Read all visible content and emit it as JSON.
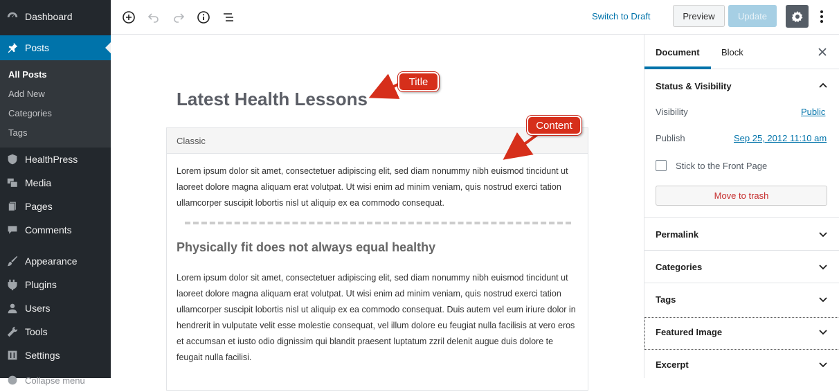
{
  "sidebar": {
    "items": [
      {
        "label": "Dashboard",
        "icon": "dashboard-icon"
      },
      {
        "label": "Posts",
        "icon": "pin-icon"
      },
      {
        "label": "HealthPress",
        "icon": "shield-icon"
      },
      {
        "label": "Media",
        "icon": "media-icon"
      },
      {
        "label": "Pages",
        "icon": "pages-icon"
      },
      {
        "label": "Comments",
        "icon": "comments-icon"
      },
      {
        "label": "Appearance",
        "icon": "brush-icon"
      },
      {
        "label": "Plugins",
        "icon": "plugin-icon"
      },
      {
        "label": "Users",
        "icon": "user-icon"
      },
      {
        "label": "Tools",
        "icon": "wrench-icon"
      },
      {
        "label": "Settings",
        "icon": "settings-icon"
      },
      {
        "label": "Collapse menu",
        "icon": "collapse-icon"
      }
    ],
    "submenu": [
      "All Posts",
      "Add New",
      "Categories",
      "Tags"
    ]
  },
  "toolbar": {
    "switch_to_draft": "Switch to Draft",
    "preview": "Preview",
    "update": "Update"
  },
  "editor": {
    "title": "Latest Health Lessons",
    "block_label": "Classic",
    "paragraph1": "Lorem ipsum dolor sit amet, consectetuer adipiscing elit, sed diam nonummy nibh euismod tincidunt ut laoreet dolore magna aliquam erat volutpat. Ut wisi enim ad minim veniam, quis nostrud exerci tation ullamcorper suscipit lobortis nisl ut aliquip ex ea commodo consequat.",
    "heading": "Physically fit does not always equal healthy",
    "paragraph2": "Lorem ipsum dolor sit amet, consectetuer adipiscing elit, sed diam nonummy nibh euismod tincidunt ut laoreet dolore magna aliquam erat volutpat. Ut wisi enim ad minim veniam, quis nostrud exerci tation ullamcorper suscipit lobortis nisl ut aliquip ex ea commodo consequat. Duis autem vel eum iriure dolor in hendrerit in vulputate velit esse molestie consequat, vel illum dolore eu feugiat nulla facilisis at vero eros et accumsan et iusto odio dignissim qui blandit praesent luptatum zzril delenit augue duis dolore te feugait nulla facilisi."
  },
  "callouts": {
    "title": "Title",
    "content": "Content"
  },
  "panel": {
    "tabs": [
      "Document",
      "Block"
    ],
    "status_heading": "Status & Visibility",
    "visibility_label": "Visibility",
    "visibility_value": "Public",
    "publish_label": "Publish",
    "publish_value": "Sep 25, 2012 11:10 am",
    "sticky_label": "Stick to the Front Page",
    "trash_button": "Move to trash",
    "sections": [
      "Permalink",
      "Categories",
      "Tags",
      "Featured Image",
      "Excerpt"
    ]
  },
  "colors": {
    "sidebar_bg": "#23282d",
    "accent": "#0073aa",
    "callout": "#d62f1b"
  }
}
